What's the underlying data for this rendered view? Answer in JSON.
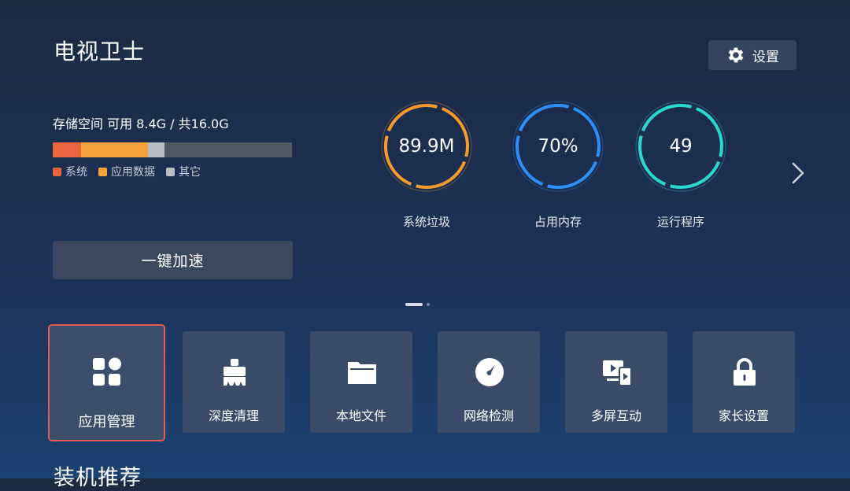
{
  "app": {
    "title": "电视卫士"
  },
  "header": {
    "settings_label": "设置",
    "settings_icon": "gear-icon"
  },
  "storage": {
    "label": "存储空间 可用 8.4G / 共16.0G",
    "available": "8.4G",
    "total": "16.0G",
    "legend": [
      {
        "label": "系统",
        "color": "#ec6541"
      },
      {
        "label": "应用数据",
        "color": "#f5a33a"
      },
      {
        "label": "其它",
        "color": "#b9bdc4"
      }
    ]
  },
  "actions": {
    "boost_label": "一键加速"
  },
  "stats": [
    {
      "value": "89.9M",
      "label": "系统垃圾",
      "color": "#f59a2c"
    },
    {
      "value": "70%",
      "label": "占用内存",
      "color": "#2f8ef5"
    },
    {
      "value": "49",
      "label": "运行程序",
      "color": "#2ad8cf"
    }
  ],
  "pager": {
    "pages": 2,
    "current": 1
  },
  "tiles": [
    {
      "label": "应用管理",
      "icon": "apps-grid-icon",
      "selected": true
    },
    {
      "label": "深度清理",
      "icon": "cleaning-brush-icon"
    },
    {
      "label": "本地文件",
      "icon": "folder-icon"
    },
    {
      "label": "网络检测",
      "icon": "speedometer-icon"
    },
    {
      "label": "多屏互动",
      "icon": "multi-screen-icon"
    },
    {
      "label": "家长设置",
      "icon": "lock-icon"
    }
  ],
  "sections": {
    "recommend_title": "装机推荐"
  }
}
